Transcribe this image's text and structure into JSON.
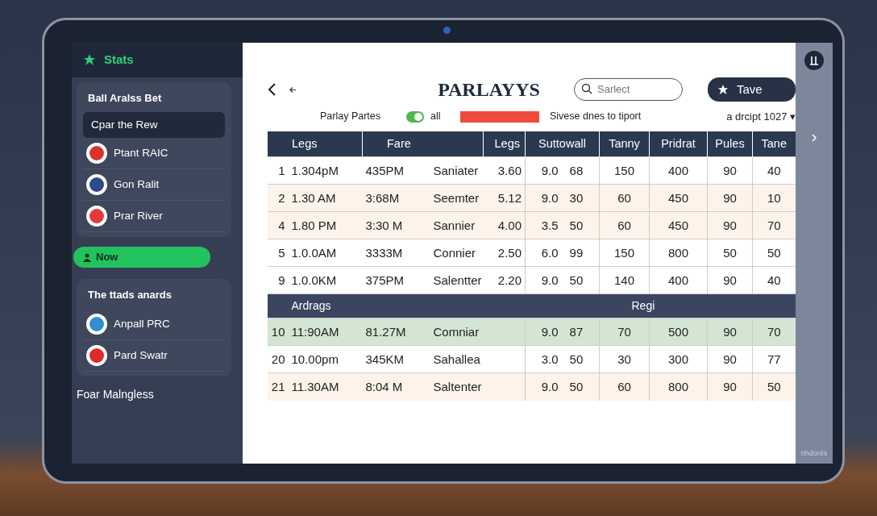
{
  "sidebar": {
    "title": "Stats",
    "cards": [
      {
        "title": "Ball Aralss Bet",
        "items": [
          {
            "label": "Cpar the Rew",
            "selected": true
          },
          {
            "label": "Ptant RAIC",
            "selected": false,
            "color": "#d9342b"
          },
          {
            "label": "Gon Ralit",
            "selected": false,
            "color": "#2c4a8c"
          },
          {
            "label": "Prar River",
            "selected": false,
            "color": "#e23a3a"
          }
        ]
      },
      {
        "kind": "pill",
        "label": "Now"
      },
      {
        "title": "The ttads anards",
        "items": [
          {
            "label": "Anpall PRC",
            "selected": false,
            "color": "#2f8fd0"
          },
          {
            "label": "Pard Swatr",
            "selected": false,
            "color": "#e02828"
          }
        ]
      }
    ],
    "footer": "Foar Malngless"
  },
  "header": {
    "title": "PARLAYYS",
    "search": {
      "placeholder": "Sarlect"
    },
    "hint": "Sivese dnes to tiport",
    "save_button": "Tave",
    "filter_label": "Parlay Partes",
    "toggle": {
      "label": "all",
      "on": true
    },
    "dropdown": "a drcipt 1027 ▾"
  },
  "table": {
    "columns": [
      "Legs",
      "Fare",
      "Legs",
      "Suttowall",
      "Tanny",
      "Pridrat",
      "Pules",
      "Tane"
    ],
    "rows": [
      {
        "color": "#ffffff",
        "cells": [
          [
            "1",
            "1.304pM"
          ],
          [
            "435PM",
            "Saniater"
          ],
          "3.60",
          [
            "9.0",
            "68"
          ],
          "150",
          "400",
          "90",
          "40"
        ]
      },
      {
        "color": "#fdf3ea",
        "cells": [
          [
            "2",
            "1.30 AM"
          ],
          [
            "3:68M",
            "Seemter"
          ],
          "5.12",
          [
            "9.0",
            "30"
          ],
          "60",
          "450",
          "90",
          "10"
        ]
      },
      {
        "color": "#fdf3ea",
        "cells": [
          [
            "4",
            "1.80 PM"
          ],
          [
            "3:30 M",
            "Sannier"
          ],
          "4.00",
          [
            "3.5",
            "50"
          ],
          "60",
          "450",
          "90",
          "70"
        ]
      },
      {
        "color": "#ffffff",
        "cells": [
          [
            "5",
            "1.0.0AM"
          ],
          [
            "3333M",
            "Connier"
          ],
          "2.50",
          [
            "6.0",
            "99"
          ],
          "150",
          "800",
          "50",
          "50"
        ]
      },
      {
        "color": "#ffffff",
        "cells": [
          [
            "9",
            "1.0.0KM"
          ],
          [
            "375PM",
            "Salentter"
          ],
          "2.20",
          [
            "9.0",
            "50"
          ],
          "140",
          "400",
          "90",
          "40"
        ]
      }
    ],
    "section": {
      "label": "Ardrags",
      "label_right": "Regi"
    },
    "rows_2": [
      {
        "color": "#d5e5d3",
        "cells": [
          [
            "10",
            "11:90AM"
          ],
          [
            "81.27M",
            "Comniar"
          ],
          null,
          [
            "9.0",
            "87"
          ],
          "70",
          "500",
          "90",
          "70"
        ]
      },
      {
        "color": "#ffffff",
        "cells": [
          [
            "20",
            "10.00pm"
          ],
          [
            "345KM",
            "Sahallea"
          ],
          null,
          [
            "3.0",
            "50"
          ],
          "30",
          "300",
          "90",
          "77"
        ]
      },
      {
        "color": "#fdf3ea",
        "cells": [
          [
            "21",
            "11.30AM"
          ],
          [
            "8:04 M",
            "Saltenter"
          ],
          null,
          [
            "9.0",
            "50"
          ],
          "60",
          "800",
          "90",
          "50"
        ]
      }
    ]
  },
  "corner_text": "nhdorés"
}
